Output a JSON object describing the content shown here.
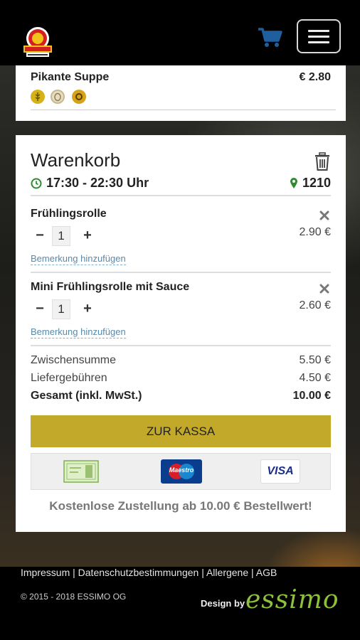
{
  "header": {
    "logo_alt": "restaurant-logo",
    "cart_icon": "shopping-cart-icon",
    "menu_icon": "hamburger-menu-icon"
  },
  "previous_item": {
    "name": "Pikante Suppe",
    "price": "€ 2.80",
    "allergens": [
      "wheat-icon",
      "egg-icon",
      "soy-icon"
    ]
  },
  "cart": {
    "title": "Warenkorb",
    "time": "17:30 - 22:30 Uhr",
    "zip": "1210",
    "items": [
      {
        "name": "Frühlingsrolle",
        "qty": "1",
        "price": "2.90 €",
        "remark": "Bemerkung hinzufügen"
      },
      {
        "name": "Mini Frühlingsrolle mit Sauce",
        "qty": "1",
        "price": "2.60 €",
        "remark": "Bemerkung hinzufügen"
      }
    ],
    "subtotal_label": "Zwischensumme",
    "subtotal": "5.50 €",
    "fee_label": "Liefergebühren",
    "fee": "4.50 €",
    "total_label": "Gesamt (inkl. MwSt.)",
    "total": "10.00 €",
    "checkout_label": "ZUR KASSA",
    "payments": {
      "maestro": "Maestro",
      "visa": "VISA"
    },
    "free_delivery": "Kostenlose Zustellung ab 10.00 € Bestellwert!"
  },
  "footer": {
    "links": [
      "Impressum",
      "Datenschutzbestimmungen",
      "Allergene",
      "AGB"
    ],
    "copyright": "© 2015 - 2018 ESSIMO OG",
    "design_by": "Design by",
    "brand": "essimo"
  },
  "colors": {
    "accent": "#c3a92a",
    "icon_green": "#2e8b2e",
    "cart_blue": "#1f5f9e",
    "link_blue": "#5a8aa8"
  }
}
